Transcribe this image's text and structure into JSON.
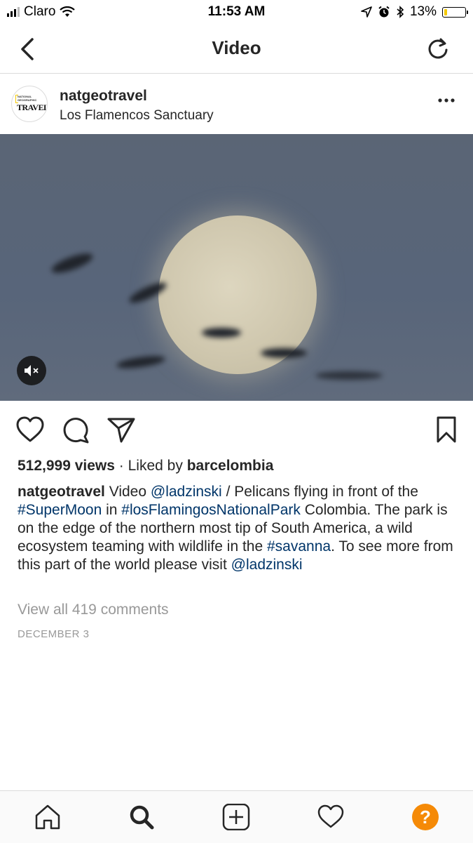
{
  "status_bar": {
    "carrier": "Claro",
    "time": "11:53 AM",
    "battery": "13%",
    "battery_level": 0.13
  },
  "nav": {
    "title": "Video",
    "back_icon": "chevron-left-icon",
    "refresh_icon": "refresh-icon"
  },
  "post": {
    "username": "natgeotravel",
    "location": "Los Flamencos Sanctuary",
    "avatar_text_top": "NATIONAL GEOGRAPHIC",
    "avatar_text_main": "TRAVEL",
    "views": "512,999 views",
    "liked_by_prefix": "· Liked by",
    "liked_by_user": "barcelombia",
    "caption": {
      "author": "natgeotravel",
      "parts": [
        {
          "text": " Video ",
          "type": "text"
        },
        {
          "text": "@ladzinski",
          "type": "link"
        },
        {
          "text": " / Pelicans flying in front of the ",
          "type": "text"
        },
        {
          "text": "#SuperMoon",
          "type": "link"
        },
        {
          "text": " in ",
          "type": "text"
        },
        {
          "text": "#losFlamingosNationalPark",
          "type": "link"
        },
        {
          "text": " Colombia. The park is on the edge of the northern most tip of South America, a wild ecosystem teaming with wildlife in the ",
          "type": "text"
        },
        {
          "text": "#savanna",
          "type": "link"
        },
        {
          "text": ". To see more from this part of the world please visit ",
          "type": "text"
        },
        {
          "text": "@ladzinski",
          "type": "link"
        }
      ]
    },
    "comments_link": "View all 419 comments",
    "date": "DECEMBER 3"
  },
  "colors": {
    "link": "#003569",
    "muted": "#999999",
    "help_badge": "#f58a07"
  },
  "tabbar": [
    "home-icon",
    "search-icon",
    "add-post-icon",
    "heart-icon",
    "help-icon"
  ]
}
